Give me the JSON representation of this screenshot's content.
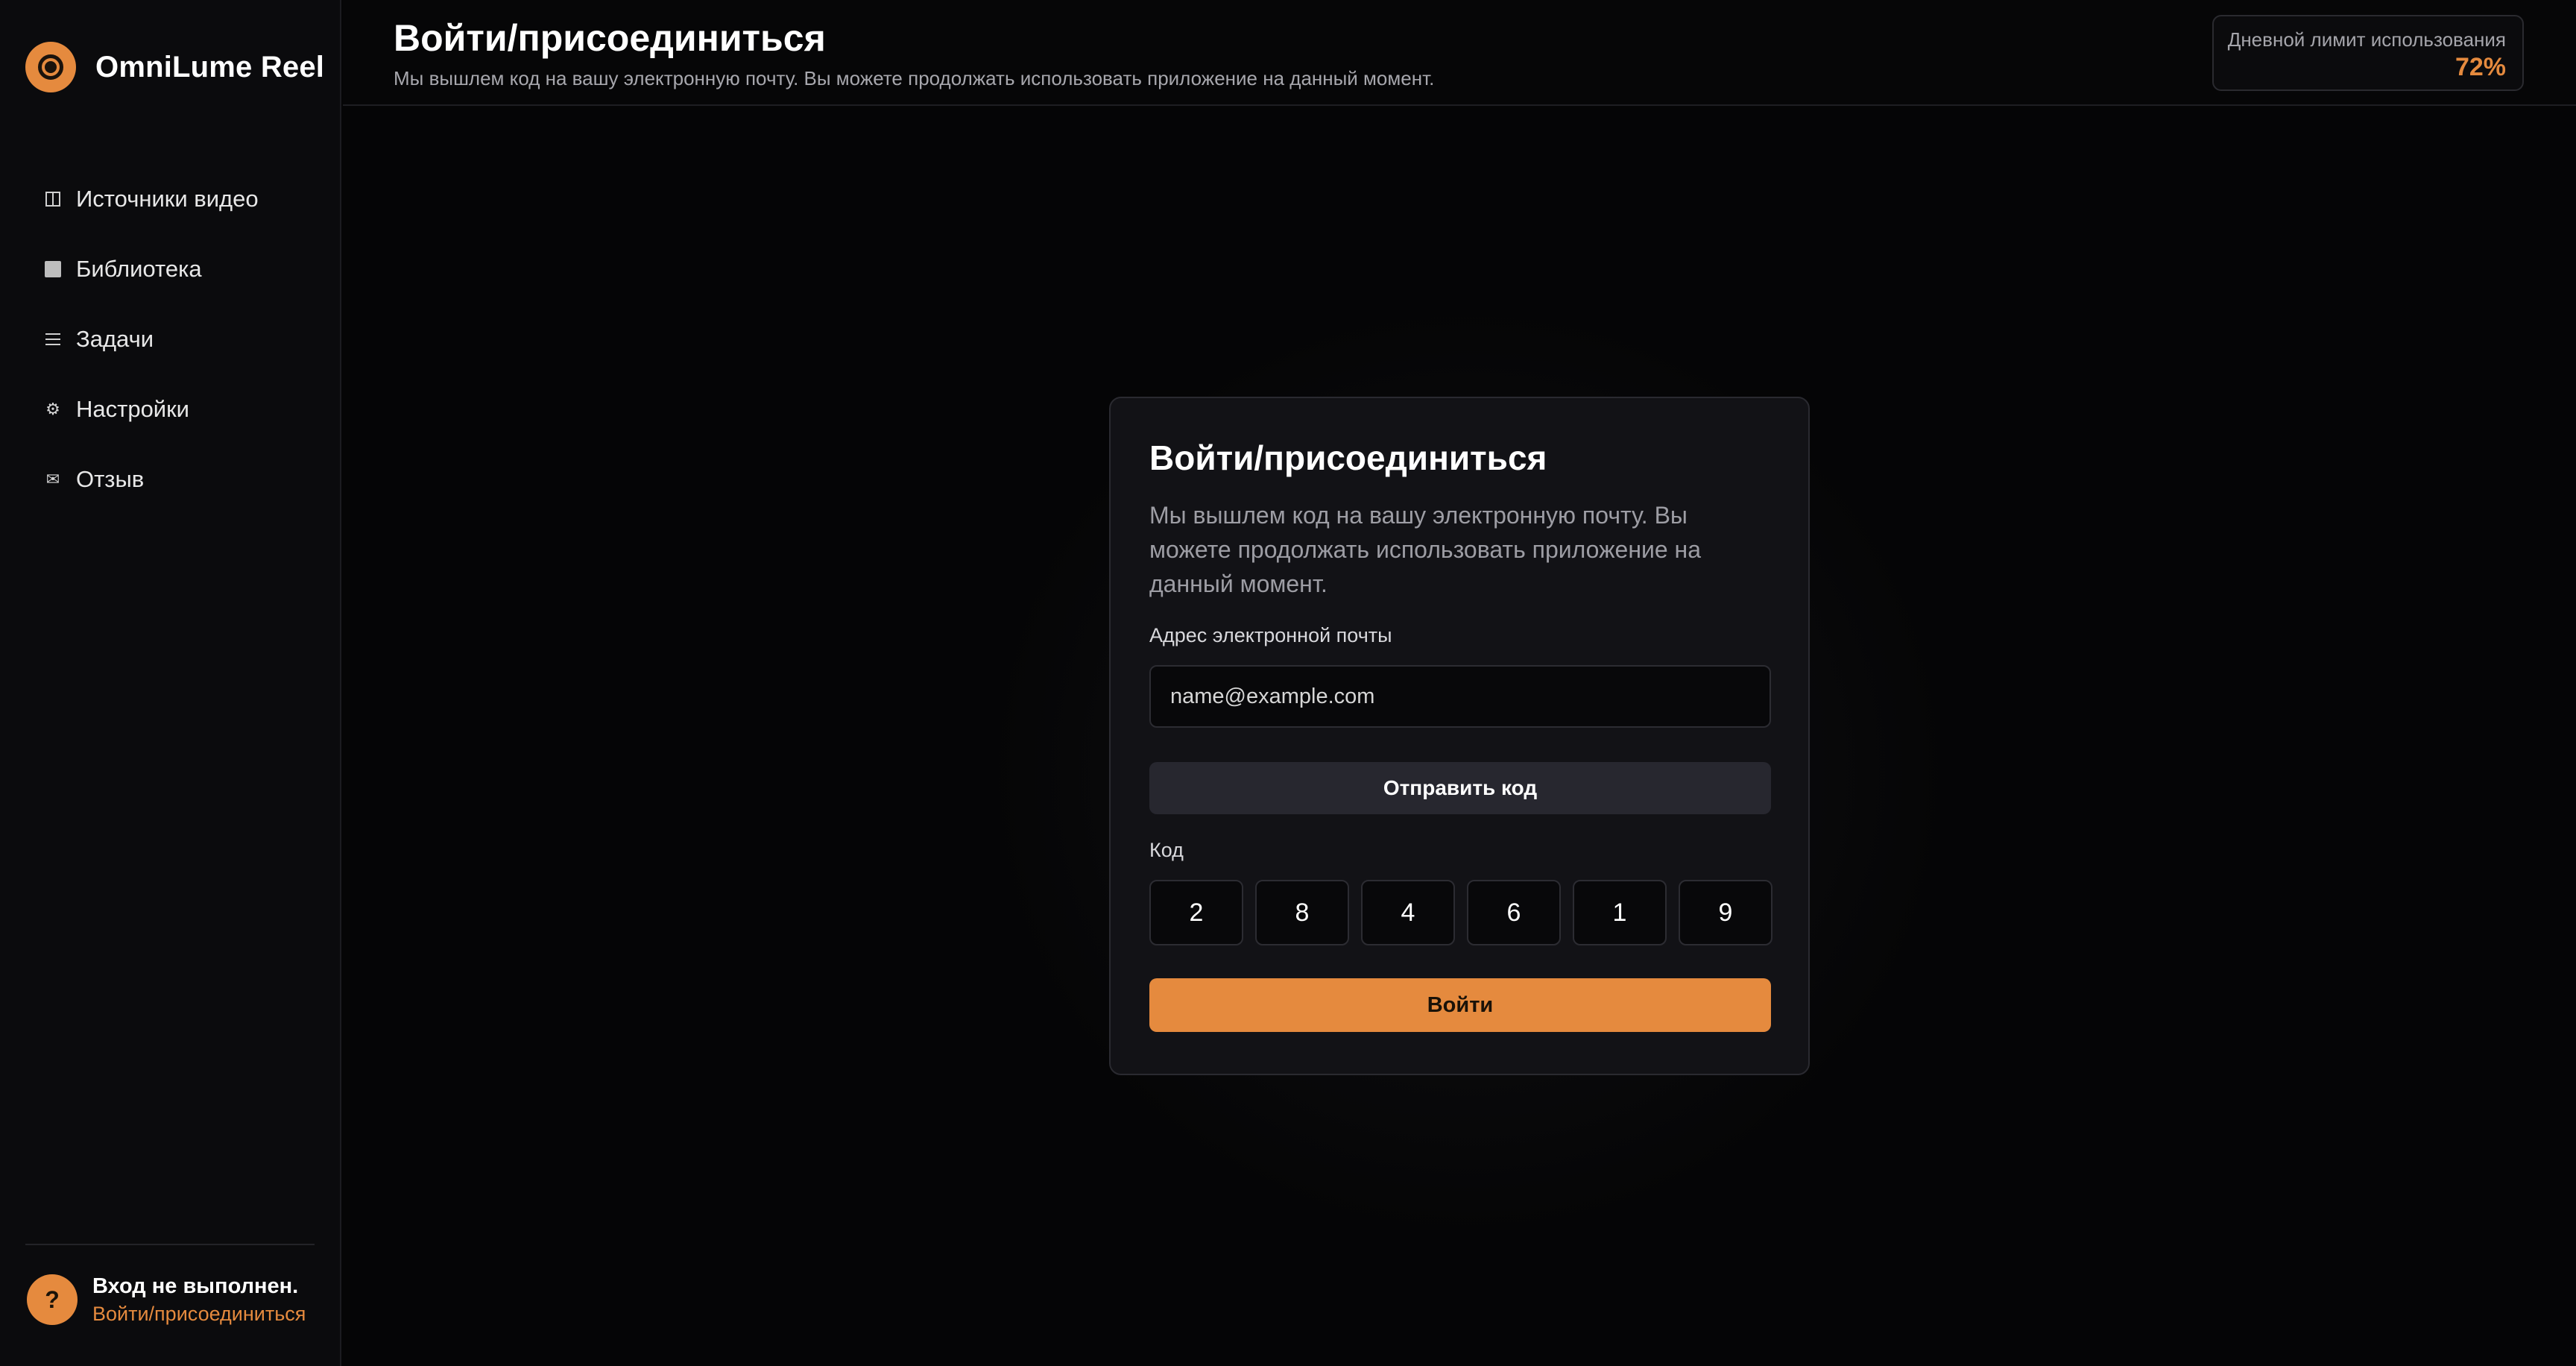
{
  "app": {
    "name": "OmniLume Reel",
    "accent_color": "#e58a3e"
  },
  "sidebar": {
    "items": [
      {
        "label": "Источники видео",
        "icon": "columns-icon"
      },
      {
        "label": "Библиотека",
        "icon": "square-icon"
      },
      {
        "label": "Задачи",
        "icon": "list-icon"
      },
      {
        "label": "Настройки",
        "icon": "gear-icon"
      },
      {
        "label": "Отзыв",
        "icon": "mail-icon"
      }
    ],
    "user": {
      "avatar": "?",
      "status": "Вход не выполнен.",
      "link": "Войти/присоединиться"
    }
  },
  "header": {
    "title": "Войти/присоединиться",
    "subtitle": "Мы вышлем код на вашу электронную почту. Вы можете продолжать использовать приложение на данный момент.",
    "usage_label": "Дневной лимит использования",
    "usage_value": "72%"
  },
  "card": {
    "title": "Войти/присоединиться",
    "description": "Мы вышлем код на вашу электронную почту. Вы можете продолжать использовать приложение на данный момент.",
    "email_label": "Адрес электронной почты",
    "email_placeholder": "name@example.com",
    "send_button": "Отправить код",
    "code_label": "Код",
    "code_digits": [
      "2",
      "8",
      "4",
      "6",
      "1",
      "9"
    ],
    "login_button": "Войти"
  }
}
